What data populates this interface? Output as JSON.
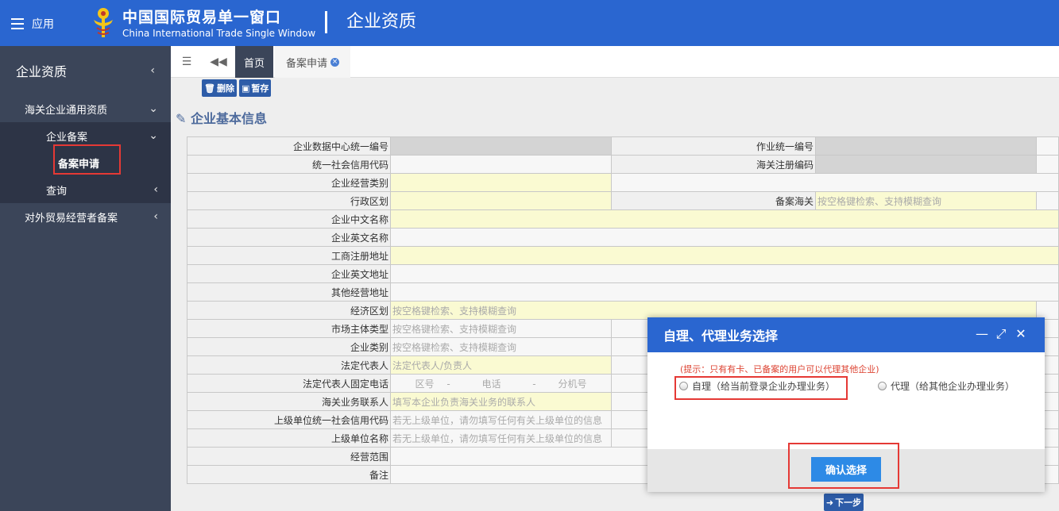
{
  "header": {
    "menu_label": "应用",
    "brand_cn": "中国国际贸易单一窗口",
    "brand_en": "China International Trade Single Window",
    "page_title": "企业资质"
  },
  "sidebar": {
    "title": "企业资质",
    "items": [
      {
        "label": "海关企业通用资质",
        "level": 1
      },
      {
        "label": "企业备案",
        "level": 2
      },
      {
        "label": "备案申请",
        "level": 3
      },
      {
        "label": "查询",
        "level": 2
      },
      {
        "label": "对外贸易经营者备案",
        "level": 1
      }
    ]
  },
  "tabs": {
    "home": "首页",
    "apply": "备案申请"
  },
  "toolbar": {
    "delete": "删除",
    "save": "暂存"
  },
  "section_title": "企业基本信息",
  "form": {
    "rows": [
      {
        "label": "企业数据中心统一编号",
        "label2": "作业统一编号",
        "value2": ""
      },
      {
        "label": "统一社会信用代码",
        "label2": "海关注册编码",
        "value2": ""
      },
      {
        "label": "企业经营类别",
        "label2": "",
        "value2": ""
      },
      {
        "label": "行政区划",
        "label2": "备案海关",
        "value2": "按空格键检索、支持模糊查询"
      },
      {
        "label": "企业中文名称"
      },
      {
        "label": "企业英文名称"
      },
      {
        "label": "工商注册地址"
      },
      {
        "label": "企业英文地址"
      },
      {
        "label": "其他经营地址"
      },
      {
        "label": "经济区划",
        "value": "按空格键检索、支持模糊查询"
      },
      {
        "label": "市场主体类型",
        "value": "按空格键检索、支持模糊查询"
      },
      {
        "label": "企业类别",
        "value": "按空格键检索、支持模糊查询"
      },
      {
        "label": "法定代表人",
        "value": "法定代表人/负责人"
      },
      {
        "label": "法定代表人固定电话",
        "value": "区号　 -　　　 电话　　　 -　　 分机号"
      },
      {
        "label": "海关业务联系人",
        "value": "填写本企业负责海关业务的联系人"
      },
      {
        "label": "上级单位统一社会信用代码",
        "value": "若无上级单位，请勿填写任何有关上级单位的信息"
      },
      {
        "label": "上级单位名称",
        "value": "若无上级单位，请勿填写任何有关上级单位的信息"
      },
      {
        "label": "经营范围"
      },
      {
        "label": "备注"
      }
    ]
  },
  "next_button": "下一步",
  "modal": {
    "title": "自理、代理业务选择",
    "tip": "(提示：只有有卡、已备案的用户可以代理其他企业)",
    "option_self": "自理（给当前登录企业办理业务）",
    "option_agent": "代理（给其他企业办理业务）",
    "confirm": "确认选择"
  },
  "colors": {
    "header_bg": "#2a66d0",
    "sidebar_bg": "#3b4559",
    "highlight_red": "#e53935",
    "confirm_blue": "#2d8ae6"
  }
}
